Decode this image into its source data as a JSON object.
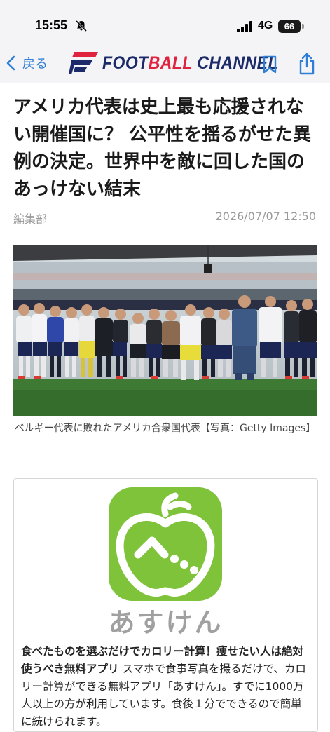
{
  "status_bar": {
    "time": "15:55",
    "network": "4G",
    "battery": "66"
  },
  "nav": {
    "back_label": "戻る",
    "logo_text_a": "FOOT",
    "logo_text_b": "BALL",
    "logo_text_c": " CHANNEL"
  },
  "article": {
    "title": "アメリカ代表は史上最も応援されない開催国に？ 公平性を揺るがせた異例の決定。世界中を敵に回した国のあっけない結末",
    "author": "編集部",
    "date": "2026/07/07 12:50",
    "photo_caption": "ベルギー代表に敗れたアメリカ合衆国代表【写真：Getty Images】"
  },
  "ad": {
    "app_name": "あすけん",
    "headline": "食べたものを選ぶだけでカロリー計算！痩せたい人は絶対使うべき無料アプリ",
    "body": " スマホで食事写真を撮るだけで、カロリー計算ができる無料アプリ「あすけん」。すでに1000万人以上の方が利用しています。食後１分でできるので簡単に続けられます。"
  },
  "colors": {
    "accent": "#2f7fd6",
    "brand_navy": "#1b2a68",
    "brand_red": "#e0223e",
    "ad_green": "#7fc33a"
  }
}
